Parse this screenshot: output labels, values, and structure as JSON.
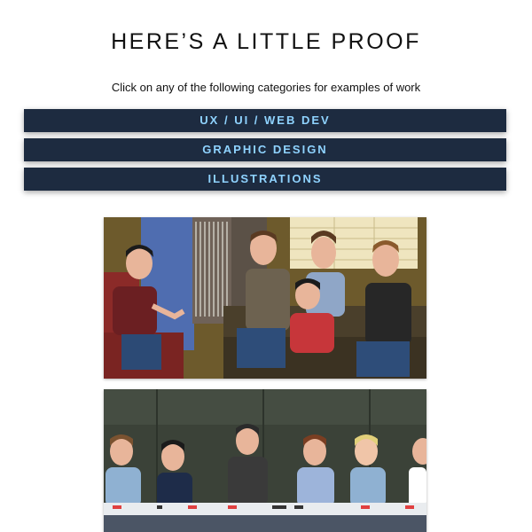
{
  "page": {
    "title": "HERE’S A LITTLE PROOF",
    "subtitle": "Click on any of the following categories for examples of work"
  },
  "categories": [
    {
      "label": "UX / UI / WEB DEV"
    },
    {
      "label": "GRAPHIC DESIGN"
    },
    {
      "label": "ILLUSTRATIONS"
    }
  ],
  "colors": {
    "button_bg": "#1d2b40",
    "button_text": "#8fd3ff"
  },
  "illustrations": [
    {
      "name": "living-room-hangout-illustration"
    },
    {
      "name": "conference-table-illustration"
    }
  ]
}
